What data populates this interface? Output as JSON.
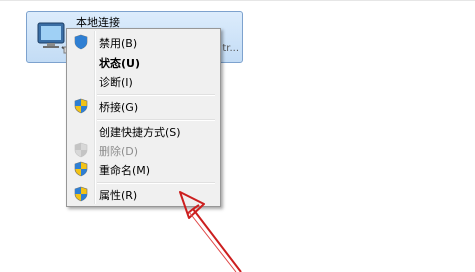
{
  "connection": {
    "title": "本地连接",
    "truncated_suffix": "tr..."
  },
  "menu": {
    "items": [
      {
        "label": "禁用(B)",
        "icon": "uac-shield-icon",
        "bold": false,
        "disabled": false
      },
      {
        "label": "状态(U)",
        "icon": "",
        "bold": true,
        "disabled": false
      },
      {
        "label": "诊断(I)",
        "icon": "",
        "bold": false,
        "disabled": false
      },
      {
        "label": "桥接(G)",
        "icon": "uac-shield-icon",
        "bold": false,
        "disabled": false
      },
      {
        "label": "创建快捷方式(S)",
        "icon": "",
        "bold": false,
        "disabled": false
      },
      {
        "label": "删除(D)",
        "icon": "uac-shield-icon",
        "bold": false,
        "disabled": true
      },
      {
        "label": "重命名(M)",
        "icon": "uac-shield-icon",
        "bold": false,
        "disabled": false
      },
      {
        "label": "属性(R)",
        "icon": "uac-shield-icon",
        "bold": false,
        "disabled": false
      }
    ]
  },
  "colors": {
    "tile_border": "#7da2ce",
    "menu_bg": "#f0f0f0",
    "annotation_arrow": "#cc1f1f"
  }
}
